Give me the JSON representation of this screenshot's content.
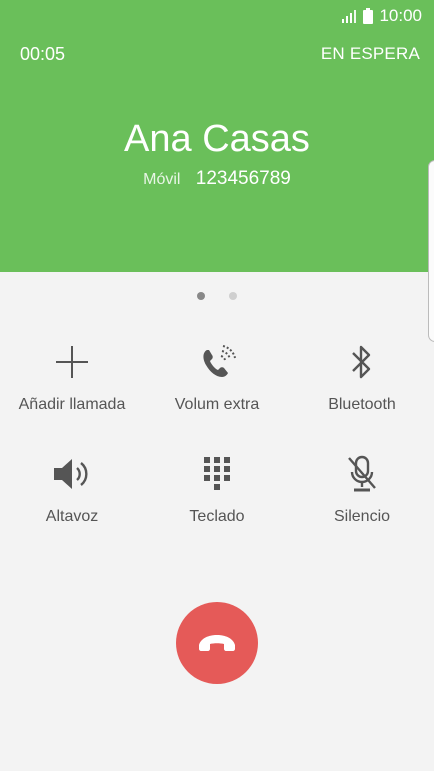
{
  "status": {
    "time": "10:00"
  },
  "call": {
    "timer": "00:05",
    "hold_label": "EN ESPERA",
    "name": "Ana Casas",
    "number_type": "Móvil",
    "number": "123456789"
  },
  "pager": {
    "pages": 2,
    "active": 0
  },
  "actions": {
    "add_call": "Añadir llamada",
    "extra_volume": "Volum extra",
    "bluetooth": "Bluetooth",
    "speaker": "Altavoz",
    "keypad": "Teclado",
    "mute": "Silencio"
  },
  "icons": {
    "add_call": "plus-icon",
    "extra_volume": "phone-volume-icon",
    "bluetooth": "bluetooth-icon",
    "speaker": "speaker-icon",
    "keypad": "keypad-icon",
    "mute": "mic-mute-icon",
    "end_call": "phone-hangup-icon"
  },
  "colors": {
    "header": "#6abf5a",
    "end_button": "#e55a58",
    "icon": "#555555"
  }
}
